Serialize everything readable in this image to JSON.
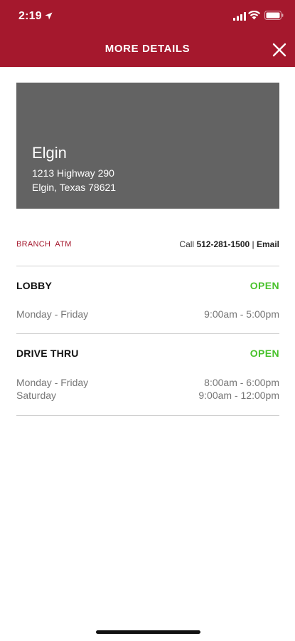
{
  "status_bar": {
    "time": "2:19"
  },
  "header": {
    "title": "MORE DETAILS"
  },
  "location": {
    "name": "Elgin",
    "address_line1": "1213 Highway 290",
    "address_line2": "Elgin, Texas 78621"
  },
  "info": {
    "type": "BRANCH  ATM",
    "call_label": "Call",
    "phone": "512-281-1500",
    "separator": "|",
    "email_label": "Email"
  },
  "lobby": {
    "title": "LOBBY",
    "status": "OPEN",
    "rows": [
      {
        "day": "Monday - Friday",
        "hours": "9:00am - 5:00pm"
      }
    ]
  },
  "drive_thru": {
    "title": "DRIVE THRU",
    "status": "OPEN",
    "rows": [
      {
        "day": "Monday - Friday",
        "hours": "8:00am - 6:00pm"
      },
      {
        "day": "Saturday",
        "hours": "9:00am - 12:00pm"
      }
    ]
  },
  "colors": {
    "brand": "#a5182d",
    "open": "#49c22c",
    "card": "#636363"
  },
  "icons": {
    "location": "location-arrow-icon",
    "signal": "cellular-signal-icon",
    "wifi": "wifi-icon",
    "battery": "battery-icon",
    "close": "close-icon"
  }
}
